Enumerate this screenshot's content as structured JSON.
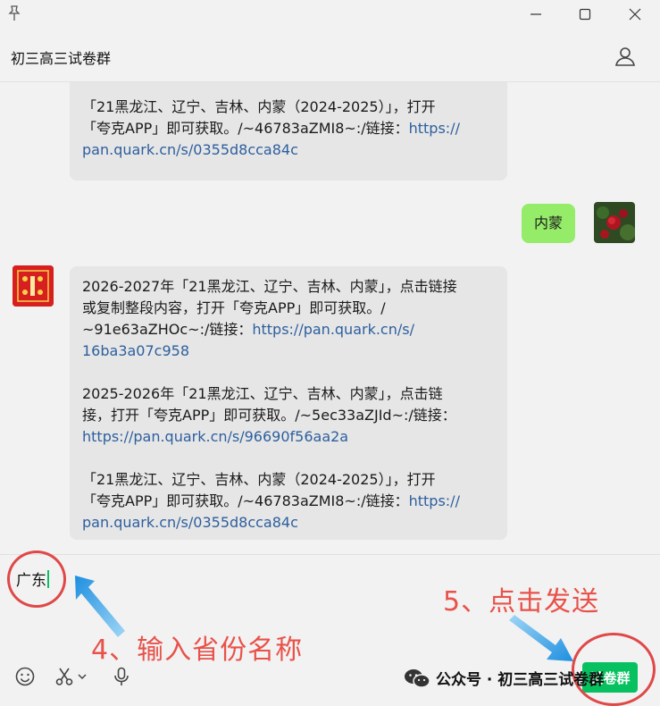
{
  "chat": {
    "title": "初三高三试卷群"
  },
  "messages": {
    "top_bubble": {
      "line1": "「21黑龙江、辽宁、吉林、内蒙（2024-2025）」，打开",
      "line2_text": "「夸克APP」即可获取。/~46783aZMI8~:/链接：",
      "line2_link": "https://",
      "line3_link": "pan.quark.cn/s/0355d8cca84c"
    },
    "sent": {
      "text": "内蒙"
    },
    "reply": {
      "p1_l1": "2026-2027年「21黑龙江、辽宁、吉林、内蒙」，点击链接",
      "p1_l2": "或复制整段内容，打开「夸克APP」即可获取。/",
      "p1_l3_text": "~91e63aZHOc~:/链接：",
      "p1_l3_link": "https://pan.quark.cn/s/",
      "p1_l4_link": "16ba3a07c958",
      "p2_l1": "2025-2026年「21黑龙江、辽宁、吉林、内蒙」，点击链",
      "p2_l2": "接，打开「夸克APP」即可获取。/~5ec33aZJId~:/链接：",
      "p2_l3_link": "https://pan.quark.cn/s/96690f56aa2a",
      "p3_l1": "「21黑龙江、辽宁、吉林、内蒙（2024-2025）」，打开",
      "p3_l2_text": "「夸克APP」即可获取。/~46783aZMI8~:/链接：",
      "p3_l2_link": "https://",
      "p3_l3_link": "pan.quark.cn/s/0355d8cca84c"
    }
  },
  "composer": {
    "input_value": "广东",
    "send_label": "试卷群"
  },
  "annotations": {
    "step4": "4、输入省份名称",
    "step5": "5、点击发送"
  },
  "watermark": {
    "text": "公众号 · 初三高三试卷群"
  },
  "icons": [
    "pin-icon",
    "minimize-icon",
    "maximize-icon",
    "close-icon",
    "person-icon",
    "emoji-icon",
    "scissors-icon",
    "chevron-down-icon",
    "microphone-icon",
    "wechat-logo-icon"
  ],
  "colors": {
    "accent": "#07c160",
    "sent_bubble": "#95ec69",
    "link": "#2d5f9e",
    "annotation": "#e8524a"
  }
}
